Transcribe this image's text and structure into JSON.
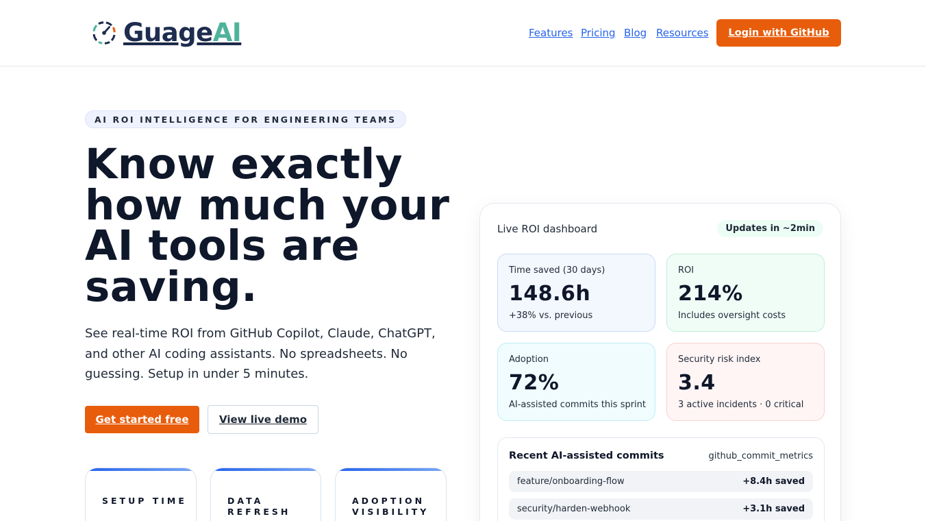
{
  "brand": {
    "name_part1": "Guage",
    "name_part2": "AI",
    "colors": {
      "navy": "#1e2d4f",
      "teal": "#4fb39b",
      "orange": "#e85d0c",
      "link": "#2563eb"
    }
  },
  "nav": {
    "items": [
      {
        "label": "Features"
      },
      {
        "label": "Pricing"
      },
      {
        "label": "Blog"
      },
      {
        "label": "Resources"
      }
    ],
    "login_label": "Login with GitHub"
  },
  "hero": {
    "eyebrow": "AI ROI INTELLIGENCE FOR ENGINEERING TEAMS",
    "title": "Know exactly how much your AI tools are saving.",
    "subtitle": "See real-time ROI from GitHub Copilot, Claude, ChatGPT, and other AI coding assistants. No spreadsheets. No guessing. Setup in under 5 minutes.",
    "primary_cta": "Get started free",
    "secondary_cta": "View live demo",
    "stat_cards": [
      {
        "label": "SETUP TIME"
      },
      {
        "label": "DATA REFRESH"
      },
      {
        "label": "ADOPTION VISIBILITY"
      }
    ]
  },
  "dashboard": {
    "title": "Live ROI dashboard",
    "badge": "Updates in ~2min",
    "metrics": [
      {
        "label": "Time saved (30 days)",
        "value": "148.6h",
        "note": "+38% vs. previous"
      },
      {
        "label": "ROI",
        "value": "214%",
        "note": "Includes oversight costs"
      },
      {
        "label": "Adoption",
        "value": "72%",
        "note": "AI-assisted commits this sprint"
      },
      {
        "label": "Security risk index",
        "value": "3.4",
        "note": "3 active incidents · 0 critical"
      }
    ],
    "commits": {
      "title": "Recent AI-assisted commits",
      "source": "github_commit_metrics",
      "rows": [
        {
          "branch": "feature/onboarding-flow",
          "saved": "+8.4h saved"
        },
        {
          "branch": "security/harden-webhook",
          "saved": "+3.1h saved"
        }
      ]
    }
  }
}
